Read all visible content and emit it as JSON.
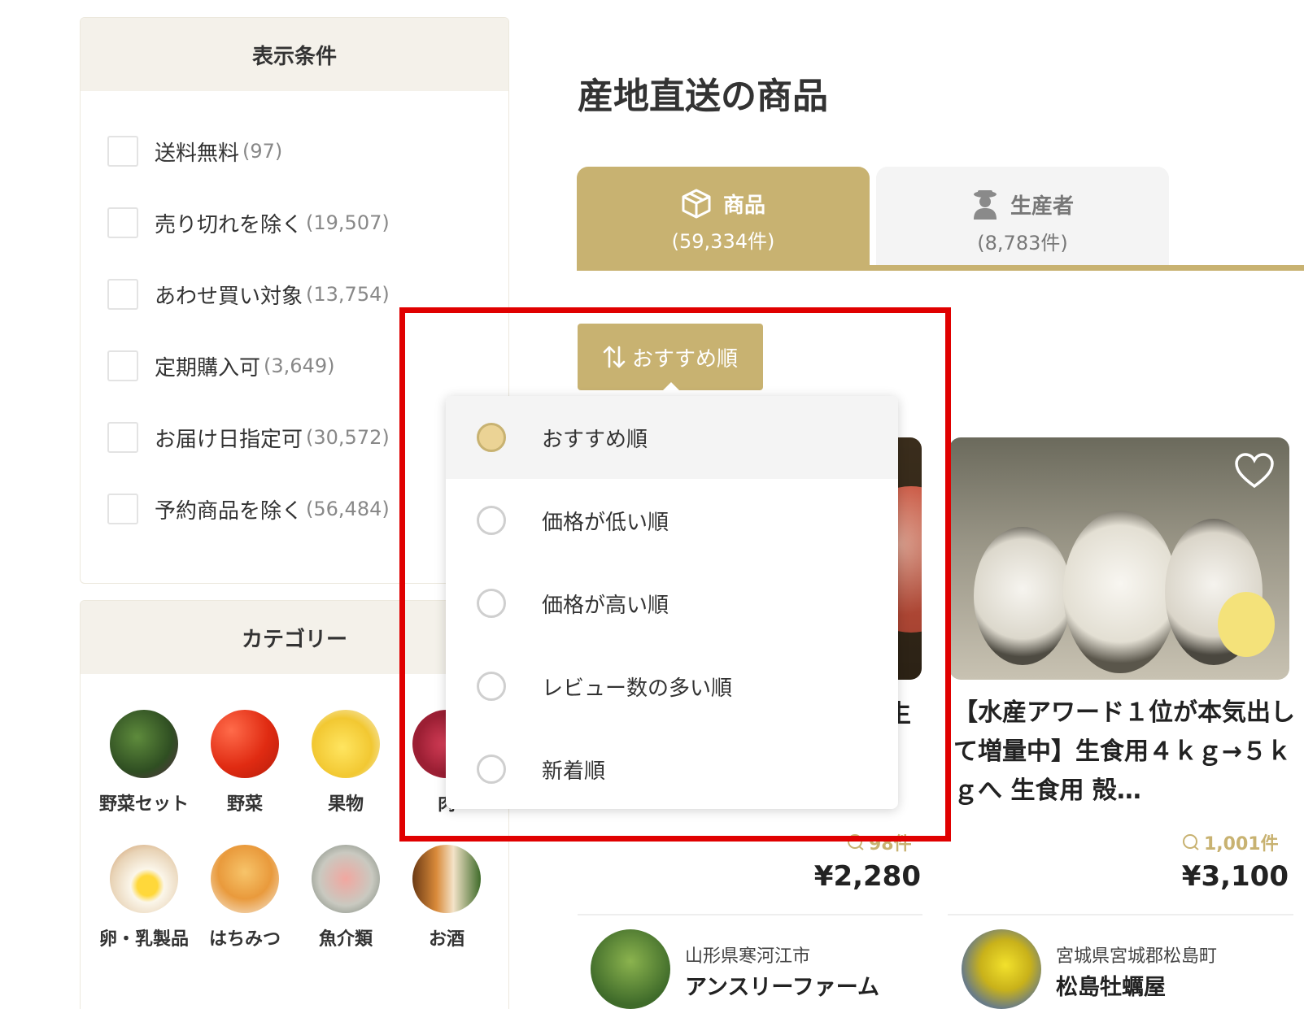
{
  "filters": {
    "title": "表示条件",
    "items": [
      {
        "label": "送料無料",
        "count": "(97)"
      },
      {
        "label": "売り切れを除く",
        "count": "(19,507)"
      },
      {
        "label": "あわせ買い対象",
        "count": "(13,754)"
      },
      {
        "label": "定期購入可",
        "count": "(3,649)"
      },
      {
        "label": "お届け日指定可",
        "count": "(30,572)"
      },
      {
        "label": "予約商品を除く",
        "count": "(56,484)"
      }
    ]
  },
  "categories": {
    "title": "カテゴリー",
    "items": [
      {
        "label": "野菜セット"
      },
      {
        "label": "野菜"
      },
      {
        "label": "果物"
      },
      {
        "label": "肉"
      },
      {
        "label": "卵・乳製品"
      },
      {
        "label": "はちみつ"
      },
      {
        "label": "魚介類"
      },
      {
        "label": "お酒"
      }
    ]
  },
  "main": {
    "title": "産地直送の商品",
    "tabs": [
      {
        "label": "商品",
        "count": "(59,334件)",
        "icon": "box-icon",
        "active": true
      },
      {
        "label": "生産者",
        "count": "(8,783件)",
        "icon": "farmer-icon",
        "active": false
      }
    ],
    "sort": {
      "label": "おすすめ順",
      "options": [
        {
          "label": "おすすめ順",
          "selected": true
        },
        {
          "label": "価格が低い順",
          "selected": false
        },
        {
          "label": "価格が高い順",
          "selected": false
        },
        {
          "label": "レビュー数の多い順",
          "selected": false
        },
        {
          "label": "新着順",
          "selected": false
        }
      ]
    },
    "products": [
      {
        "title_fragment": "生",
        "reviews": "98件",
        "price": "¥2,280",
        "producer_location": "山形県寒河江市",
        "producer_name": "アンスリーファーム"
      },
      {
        "title": "【水産アワード１位が本気出して増量中】生食用４ｋｇ→５ｋｇへ 生食用 殻…",
        "reviews": "1,001件",
        "price": "¥3,100",
        "producer_location": "宮城県宮城郡松島町",
        "producer_name": "松島牡蠣屋"
      }
    ]
  },
  "colors": {
    "accent": "#c8b271",
    "panel_header": "#f4f1ea",
    "highlight": "#e00000"
  }
}
